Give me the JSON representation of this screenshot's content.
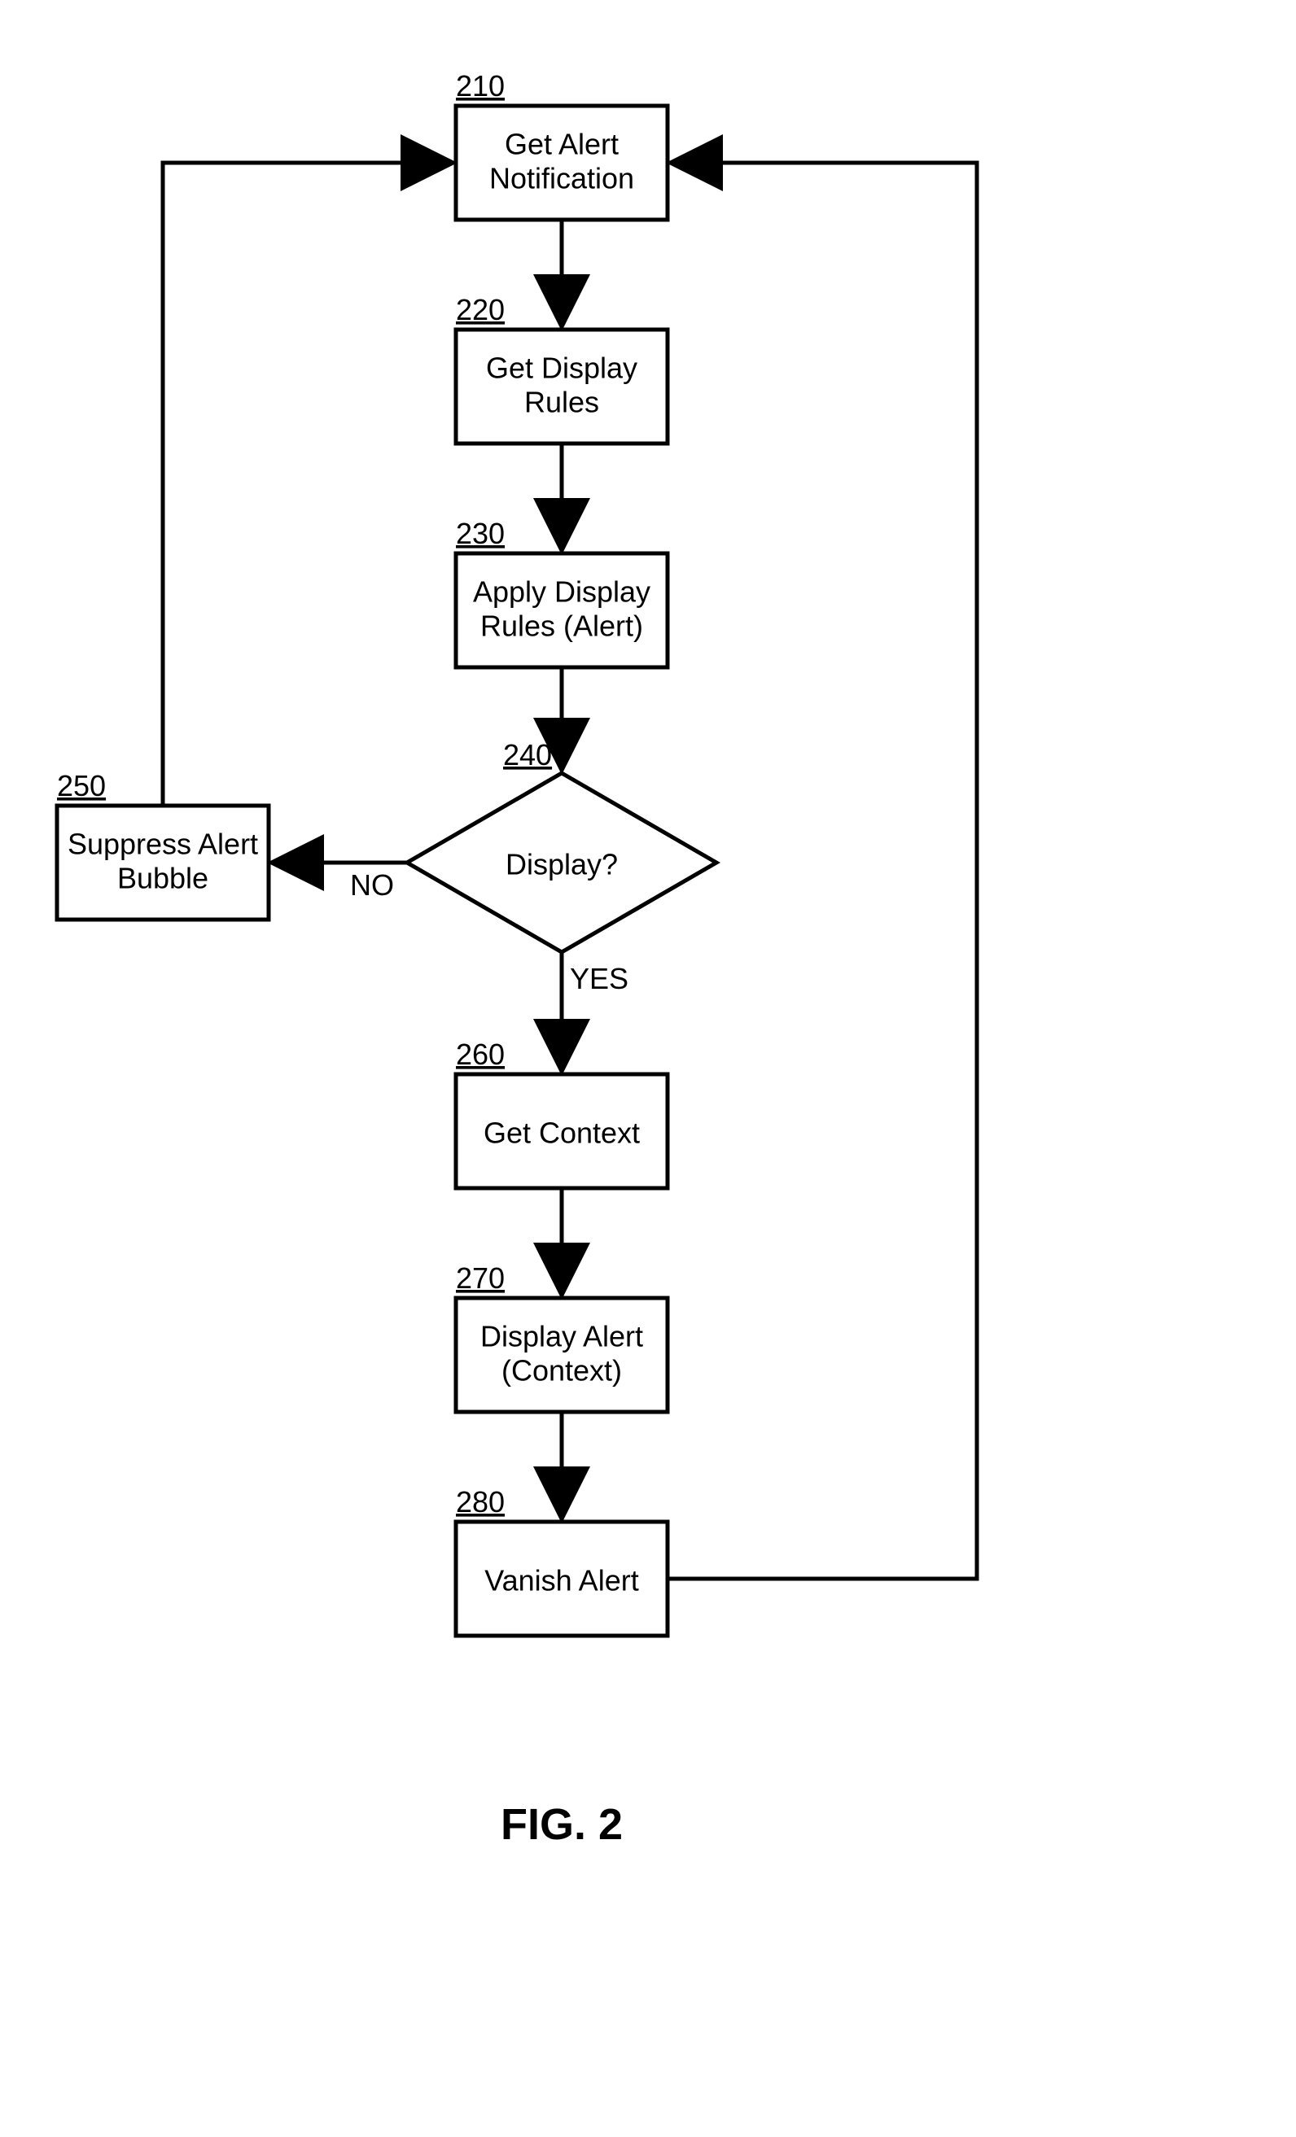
{
  "figure_label": "FIG. 2",
  "nodes": {
    "n210": {
      "ref": "210",
      "lines": [
        "Get Alert",
        "Notification"
      ]
    },
    "n220": {
      "ref": "220",
      "lines": [
        "Get Display",
        "Rules"
      ]
    },
    "n230": {
      "ref": "230",
      "lines": [
        "Apply Display",
        "Rules (Alert)"
      ]
    },
    "n240": {
      "ref": "240",
      "lines": [
        "Display?"
      ]
    },
    "n250": {
      "ref": "250",
      "lines": [
        "Suppress Alert",
        "Bubble"
      ]
    },
    "n260": {
      "ref": "260",
      "lines": [
        "Get Context"
      ]
    },
    "n270": {
      "ref": "270",
      "lines": [
        "Display Alert",
        "(Context)"
      ]
    },
    "n280": {
      "ref": "280",
      "lines": [
        "Vanish Alert"
      ]
    }
  },
  "branches": {
    "no": "NO",
    "yes": "YES"
  }
}
